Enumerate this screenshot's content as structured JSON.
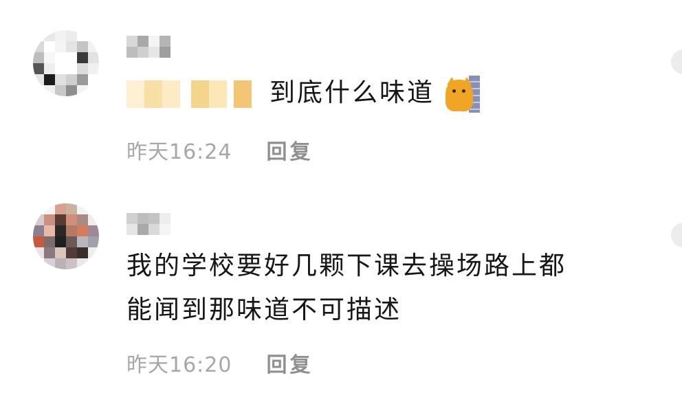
{
  "comments": [
    {
      "text": "到底什么味道",
      "time": "昨天16:24",
      "reply_label": "回复",
      "has_blurred_prefix": true,
      "trailing_emoji": "cat-peeking-emoji"
    },
    {
      "text_line1": "我的学校要好几颗下课去操场路上都",
      "text_line2": "能闻到那味道不可描述",
      "time": "昨天16:20",
      "reply_label": "回复"
    }
  ],
  "colors": {
    "text": "#161616",
    "meta": "#a7a7a7",
    "reply": "#8f8f8f",
    "background": "#ffffff"
  }
}
